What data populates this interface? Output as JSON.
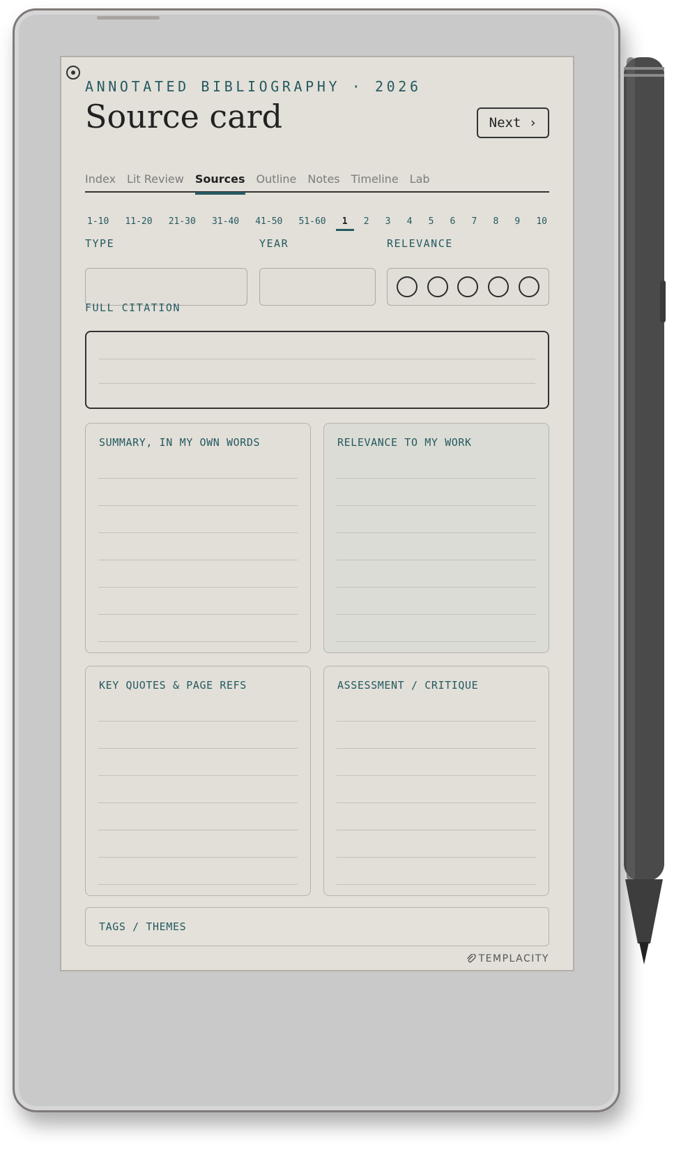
{
  "header": {
    "eyebrow": "ANNOTATED BIBLIOGRAPHY · 2026",
    "title": "Source card",
    "next_label": "Next ›"
  },
  "tabs": [
    {
      "label": "Index",
      "active": false
    },
    {
      "label": "Lit Review",
      "active": false
    },
    {
      "label": "Sources",
      "active": true
    },
    {
      "label": "Outline",
      "active": false
    },
    {
      "label": "Notes",
      "active": false
    },
    {
      "label": "Timeline",
      "active": false
    },
    {
      "label": "Lab",
      "active": false
    }
  ],
  "pagenav": {
    "ranges": [
      "1-10",
      "11-20",
      "21-30",
      "31-40",
      "41-50",
      "51-60"
    ],
    "pages": [
      "1",
      "2",
      "3",
      "4",
      "5",
      "6",
      "7",
      "8",
      "9",
      "10"
    ],
    "active_page": "1"
  },
  "fields": {
    "type_label": "TYPE",
    "year_label": "YEAR",
    "relevance_label": "RELEVANCE",
    "relevance_max": 5,
    "relevance_filled": 0,
    "citation_label": "FULL CITATION"
  },
  "panels": {
    "summary": "SUMMARY, IN MY OWN WORDS",
    "relevance": "RELEVANCE TO MY WORK",
    "quotes": "KEY QUOTES & PAGE REFS",
    "assessment": "ASSESSMENT / CRITIQUE",
    "tags": "TAGS / THEMES"
  },
  "brand": {
    "name": "TEMPLACITY",
    "icon": "paperclip-icon"
  },
  "colors": {
    "accent": "#245a60",
    "paper": "#e3e0d9",
    "ink": "#222222"
  }
}
